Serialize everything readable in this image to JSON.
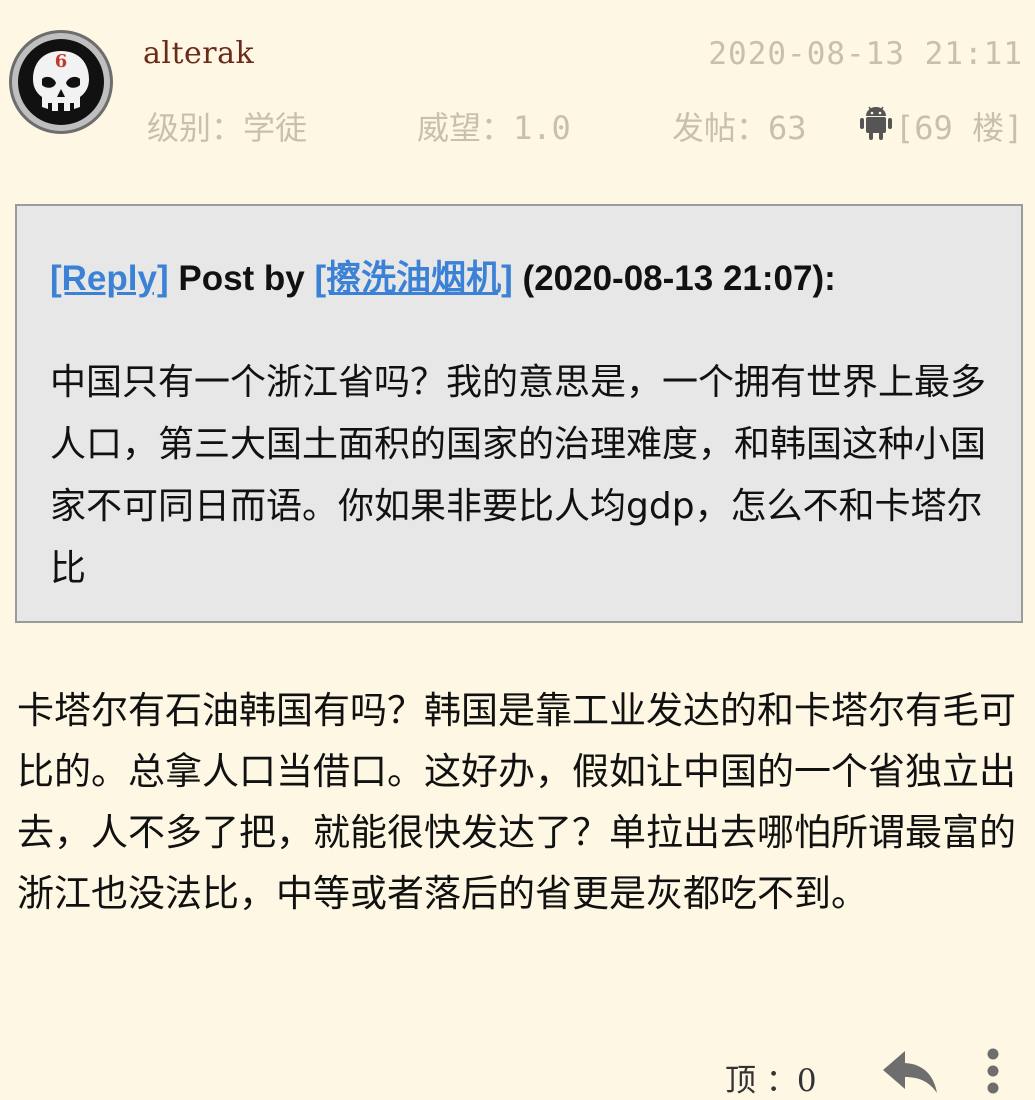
{
  "post": {
    "username": "alterak",
    "timestamp": "2020-08-13 21:11",
    "avatar_level": "6",
    "meta": {
      "level": "级别：学徒",
      "reputation": "威望：1.0",
      "posts": "发帖：63",
      "floor": "[69 楼]"
    },
    "quote": {
      "reply_link": "[Reply]",
      "post_by": " Post by ",
      "author_link": "[擦洗油烟机]",
      "date": " (2020-08-13 21:07):",
      "body": "中国只有一个浙江省吗？我的意思是，一个拥有世界上最多人口，第三大国土面积的国家的治理难度，和韩国这种小国家不可同日而语。你如果非要比人均gdp，怎么不和卡塔尔比"
    },
    "body": "卡塔尔有石油韩国有吗？韩国是靠工业发达的和卡塔尔有毛可比的。总拿人口当借口。这好办，假如让中国的一个省独立出去，人不多了把，就能很快发达了？单拉出去哪怕所谓最富的浙江也没法比，中等或者落后的省更是灰都吃不到。",
    "actions": {
      "ding": "顶 ：0"
    }
  },
  "icons": [
    "punisher-skull-avatar",
    "android-icon",
    "reply-icon",
    "more-vertical-icon"
  ],
  "colors": {
    "background": "#fdf7e4",
    "username": "#6b2a1a",
    "meta_gray": "#c9c0ac",
    "link_blue": "#3b82d6",
    "quote_bg": "#e7e7e7"
  }
}
